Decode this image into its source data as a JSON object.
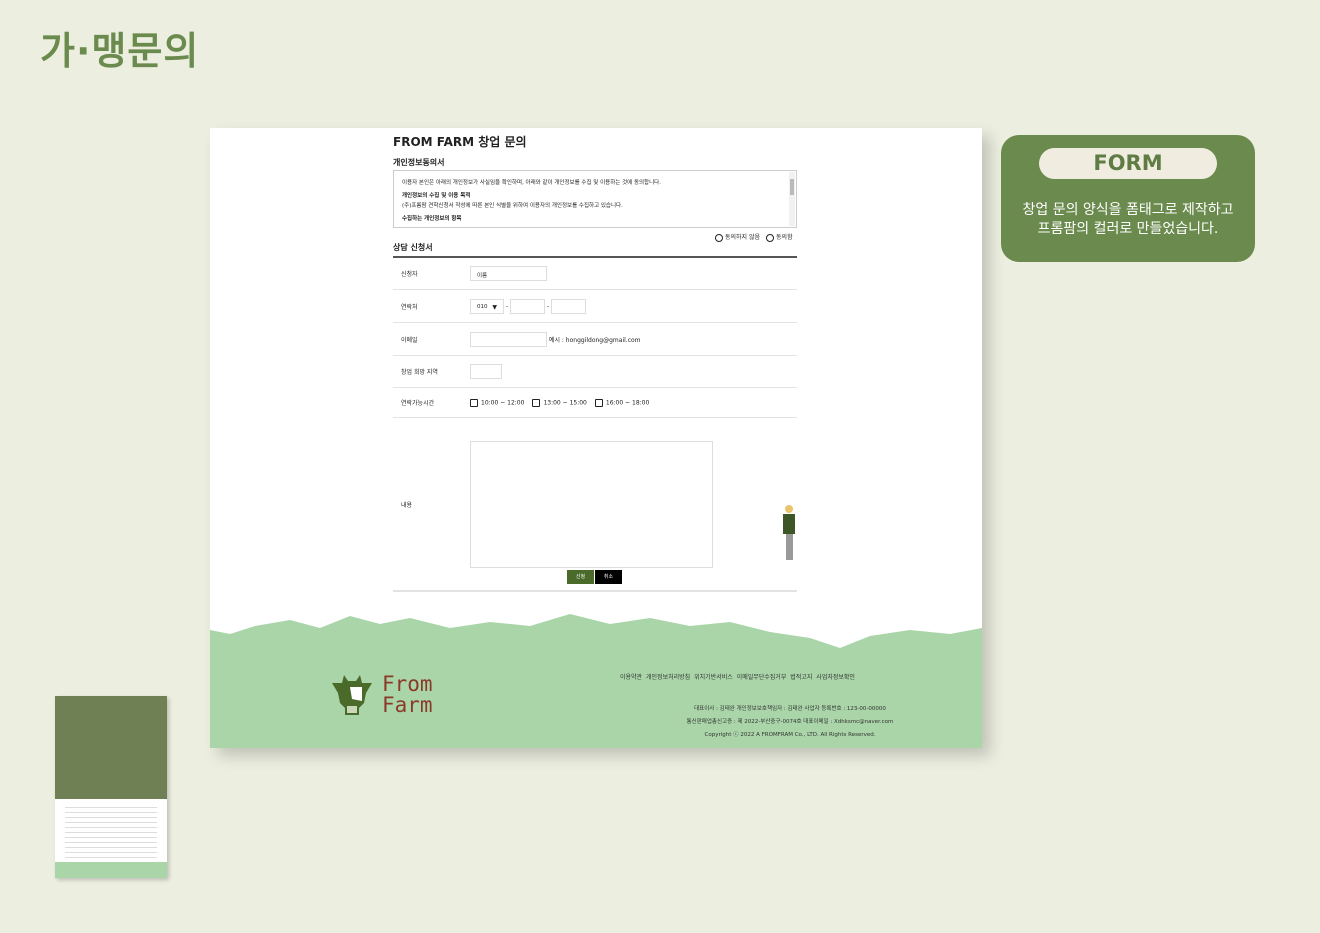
{
  "heading": "가·맹문의",
  "form_page": {
    "title": "FROM FARM 창업 문의",
    "terms_title": "개인정보동의서",
    "terms": {
      "intro": "이용자 본인은 아래의 개인정보가 사실임을 확인하며, 아래와 같이 개인정보를 수집 및 이용하는 것에 동의합니다.",
      "purpose_title": "개인정보의 수집 및 이용 목적",
      "purpose_text": "(주)프롬팜 견학신청서 작성에 따른 본인 식별을 위하여 이용자의 개인정보를 수집하고 있습니다.",
      "items_title": "수집하는 개인정보의 항목"
    },
    "agree_options": [
      "동의하지 않음",
      "동의함"
    ],
    "form_title": "상담 신청서",
    "fields": {
      "name_label": "신청자",
      "name_placeholder": "이름",
      "phone_label": "연락처",
      "phone_prefix": "010",
      "email_label": "이메일",
      "email_hint": "예시 : honggildong@gmail.com",
      "region_label": "창업 희망 지역",
      "time_label": "연락가능시간",
      "time_options": [
        "10:00 ~ 12:00",
        "13:00 ~ 15:00",
        "16:00 ~ 18:00"
      ],
      "content_label": "내용"
    },
    "submit_label": "신청",
    "cancel_label": "취소",
    "footer": {
      "logo_line1": "From",
      "logo_line2": "Farm",
      "links": [
        "이용약관",
        "개인정보처리방침",
        "위치기반서비스",
        "이메일무단수집거부",
        "법적고지",
        "사업자정보확인"
      ],
      "info1": "대표이사 : 김태완 개인정보보호책임자 : 김태완 사업자 등록번호 : 123-00-00000",
      "info2": "통신판매업총신고증 : 제 2022-부산중구-0074호 대표이메일 : Xdhksmc@naver.com",
      "copyright": "Copyright ⓒ 2022 A FROMFRAM Co., LTD. All Rights Reserved."
    }
  },
  "card": {
    "label": "FORM",
    "line1": "창업 문의 양식을 폼태그로 제작하고",
    "line2": "프롬팜의 컬러로 만들었습니다."
  },
  "colors": {
    "brand_green": "#6b8a4e",
    "footer_green": "#a9d5a8",
    "dark_green": "#4a6a2a"
  }
}
